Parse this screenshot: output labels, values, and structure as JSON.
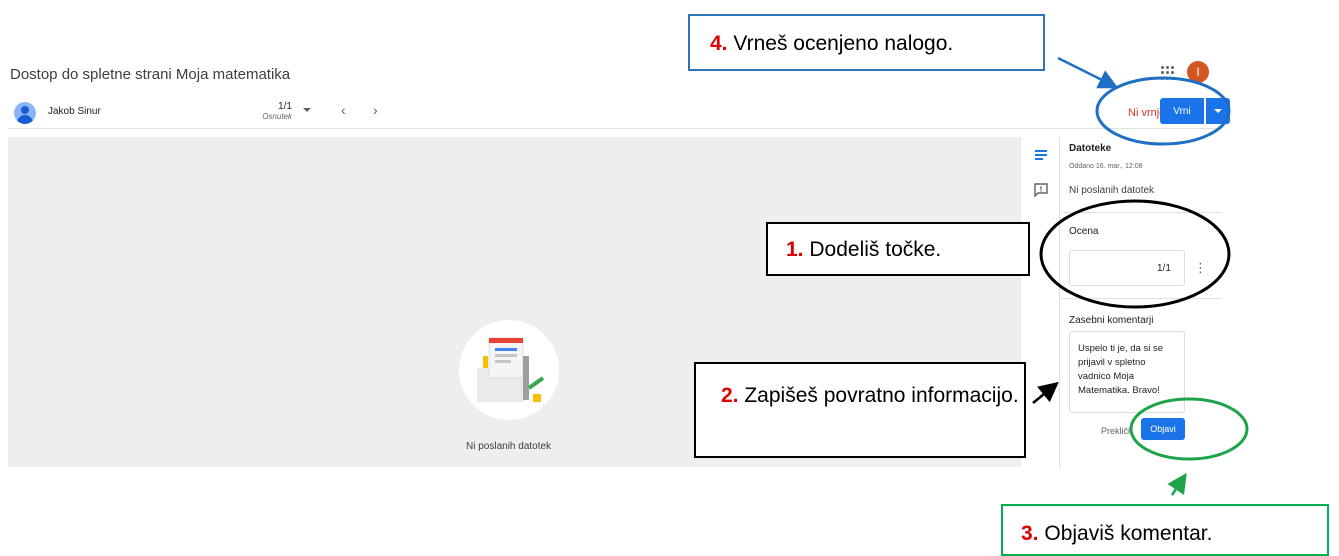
{
  "header": {
    "title": "Dostop do spletne strani Moja matematika",
    "account_initial": "I"
  },
  "toolbar": {
    "student_name": "Jakob Sinur",
    "counter": "1/1",
    "counter_status": "Osnutek",
    "return_status": "Ni vrnjeno",
    "return_label": "Vrni"
  },
  "viewer": {
    "empty_text": "Ni poslanih datotek"
  },
  "panel": {
    "files_title": "Datoteke",
    "submitted_at": "Oddano 16. mar., 12:08",
    "no_files": "Ni poslanih datotek",
    "grade_label": "Ocena",
    "grade_value": "1/1",
    "comments_title": "Zasebni komentarji",
    "comment_text": "Uspelo ti je, da si se prijavil v spletno vadnico Moja Matematika. Bravo!",
    "cancel_label": "Prekliči",
    "post_label": "Objavi"
  },
  "callouts": {
    "c1": {
      "num": "1.",
      "text": "Dodeliš točke."
    },
    "c2": {
      "num": "2.",
      "text": "Zapišeš povratno informacijo."
    },
    "c3": {
      "num": "3.",
      "text": "Objaviš komentar."
    },
    "c4": {
      "num": "4.",
      "text": "Vrneš ocenjeno nalogo."
    }
  },
  "colors": {
    "primary": "#1a73e8",
    "status_red": "#d93025",
    "callout_blue": "#2e75b6",
    "callout_green": "#00b050",
    "callout_number": "#e00000"
  }
}
